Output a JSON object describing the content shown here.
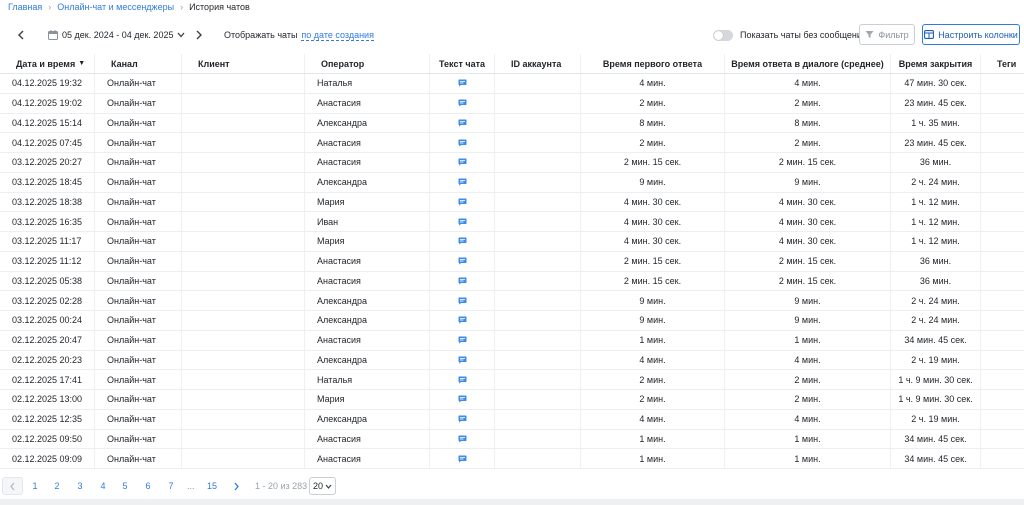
{
  "breadcrumb": {
    "home": "Главная",
    "section": "Онлайн-чат и мессенджеры",
    "current": "История чатов"
  },
  "toolbar": {
    "date_range": "05 дек. 2024 - 04 дек. 2025",
    "display_by_label": "Отображать чаты",
    "display_by_value": "по дате создания",
    "toggle_label": "Показать чаты без сообщений",
    "toggle_on": false,
    "filter_label": "Фильтр",
    "columns_label": "Настроить колонки"
  },
  "table": {
    "headers": [
      "Дата и время",
      "Канал",
      "Клиент",
      "Оператор",
      "Текст чата",
      "ID аккаунта",
      "Время первого ответа",
      "Время ответа в диалоге (среднее)",
      "Время закрытия",
      "Теги"
    ],
    "sort_indicator": "▼",
    "rows": [
      [
        "04.12.2025 19:32",
        "Онлайн-чат",
        "",
        "Наталья",
        "",
        "",
        "4 мин.",
        "4 мин.",
        "47 мин. 30 сек.",
        ""
      ],
      [
        "04.12.2025 19:02",
        "Онлайн-чат",
        "",
        "Анастасия",
        "",
        "",
        "2 мин.",
        "2 мин.",
        "23 мин. 45 сек.",
        ""
      ],
      [
        "04.12.2025 15:14",
        "Онлайн-чат",
        "",
        "Александра",
        "",
        "",
        "8 мин.",
        "8 мин.",
        "1 ч. 35 мин.",
        ""
      ],
      [
        "04.12.2025 07:45",
        "Онлайн-чат",
        "",
        "Анастасия",
        "",
        "",
        "2 мин.",
        "2 мин.",
        "23 мин. 45 сек.",
        ""
      ],
      [
        "03.12.2025 20:27",
        "Онлайн-чат",
        "",
        "Анастасия",
        "",
        "",
        "2 мин. 15 сек.",
        "2 мин. 15 сек.",
        "36 мин.",
        ""
      ],
      [
        "03.12.2025 18:45",
        "Онлайн-чат",
        "",
        "Александра",
        "",
        "",
        "9 мин.",
        "9 мин.",
        "2 ч. 24 мин.",
        ""
      ],
      [
        "03.12.2025 18:38",
        "Онлайн-чат",
        "",
        "Мария",
        "",
        "",
        "4 мин. 30 сек.",
        "4 мин. 30 сек.",
        "1 ч. 12 мин.",
        ""
      ],
      [
        "03.12.2025 16:35",
        "Онлайн-чат",
        "",
        "Иван",
        "",
        "",
        "4 мин. 30 сек.",
        "4 мин. 30 сек.",
        "1 ч. 12 мин.",
        ""
      ],
      [
        "03.12.2025 11:17",
        "Онлайн-чат",
        "",
        "Мария",
        "",
        "",
        "4 мин. 30 сек.",
        "4 мин. 30 сек.",
        "1 ч. 12 мин.",
        ""
      ],
      [
        "03.12.2025 11:12",
        "Онлайн-чат",
        "",
        "Анастасия",
        "",
        "",
        "2 мин. 15 сек.",
        "2 мин. 15 сек.",
        "36 мин.",
        ""
      ],
      [
        "03.12.2025 05:38",
        "Онлайн-чат",
        "",
        "Анастасия",
        "",
        "",
        "2 мин. 15 сек.",
        "2 мин. 15 сек.",
        "36 мин.",
        ""
      ],
      [
        "03.12.2025 02:28",
        "Онлайн-чат",
        "",
        "Александра",
        "",
        "",
        "9 мин.",
        "9 мин.",
        "2 ч. 24 мин.",
        ""
      ],
      [
        "03.12.2025 00:24",
        "Онлайн-чат",
        "",
        "Александра",
        "",
        "",
        "9 мин.",
        "9 мин.",
        "2 ч. 24 мин.",
        ""
      ],
      [
        "02.12.2025 20:47",
        "Онлайн-чат",
        "",
        "Анастасия",
        "",
        "",
        "1 мин.",
        "1 мин.",
        "34 мин. 45 сек.",
        ""
      ],
      [
        "02.12.2025 20:23",
        "Онлайн-чат",
        "",
        "Александра",
        "",
        "",
        "4 мин.",
        "4 мин.",
        "2 ч. 19 мин.",
        ""
      ],
      [
        "02.12.2025 17:41",
        "Онлайн-чат",
        "",
        "Наталья",
        "",
        "",
        "2 мин.",
        "2 мин.",
        "1 ч. 9 мин. 30 сек.",
        ""
      ],
      [
        "02.12.2025 13:00",
        "Онлайн-чат",
        "",
        "Мария",
        "",
        "",
        "2 мин.",
        "2 мин.",
        "1 ч. 9 мин. 30 сек.",
        ""
      ],
      [
        "02.12.2025 12:35",
        "Онлайн-чат",
        "",
        "Александра",
        "",
        "",
        "4 мин.",
        "4 мин.",
        "2 ч. 19 мин.",
        ""
      ],
      [
        "02.12.2025 09:50",
        "Онлайн-чат",
        "",
        "Анастасия",
        "",
        "",
        "1 мин.",
        "1 мин.",
        "34 мин. 45 сек.",
        ""
      ],
      [
        "02.12.2025 09:09",
        "Онлайн-чат",
        "",
        "Анастасия",
        "",
        "",
        "1 мин.",
        "1 мин.",
        "34 мин. 45 сек.",
        ""
      ]
    ]
  },
  "pagination": {
    "pages": [
      "1",
      "2",
      "3",
      "4",
      "5",
      "6",
      "7"
    ],
    "ellipsis": "...",
    "last_page": "15",
    "info": "1 - 20 из 283",
    "page_size": "20"
  },
  "colors": {
    "accent": "#2f7be0",
    "chat_icon": "#3d8bea"
  },
  "icons": {
    "prev": "chevron-left-icon",
    "next": "chevron-right-icon",
    "calendar": "calendar-icon",
    "filter": "filter-icon",
    "columns": "columns-icon",
    "chat": "chat-bubble-icon"
  }
}
